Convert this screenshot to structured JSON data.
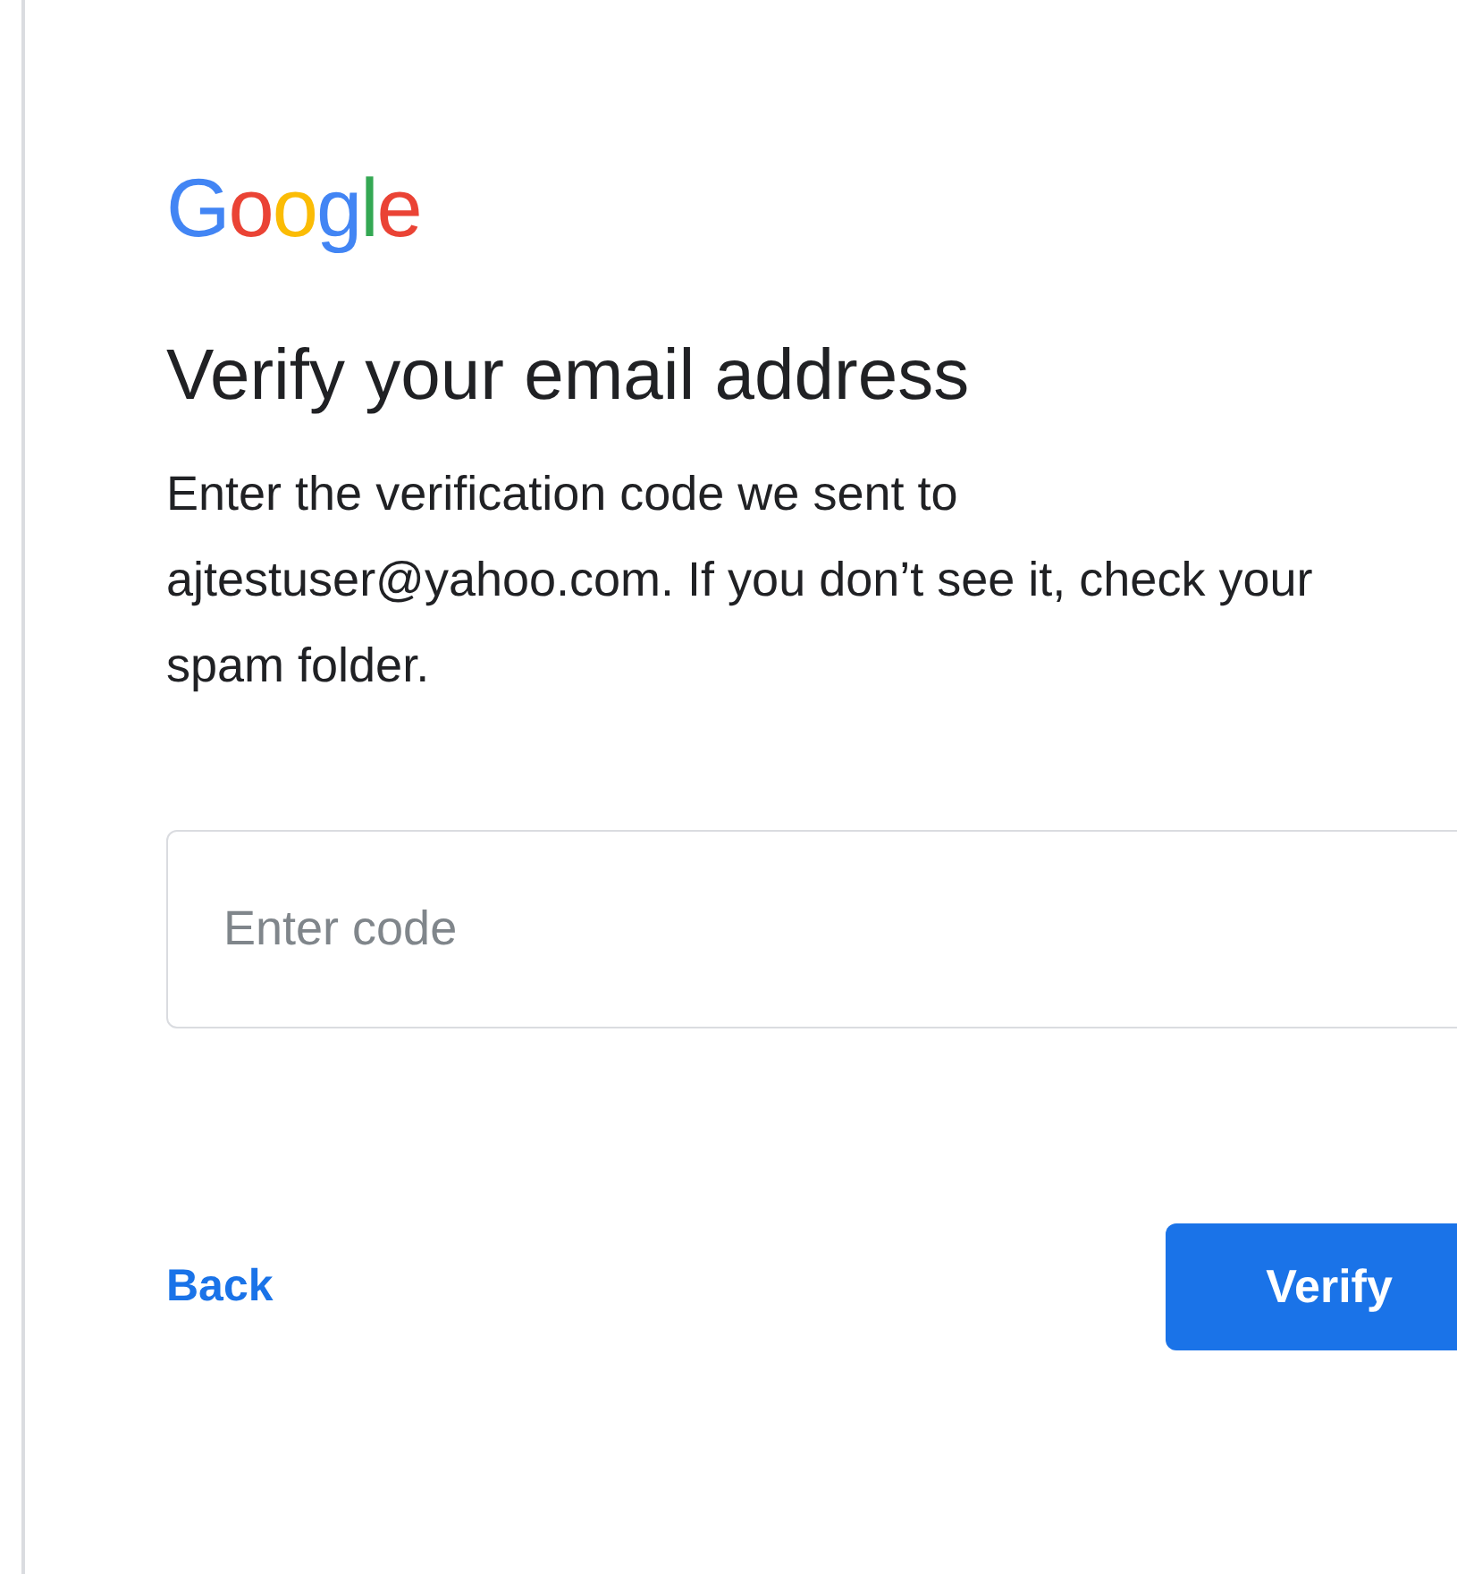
{
  "logo": {
    "letters": [
      {
        "char": "G",
        "color": "#4285f4"
      },
      {
        "char": "o",
        "color": "#ea4335"
      },
      {
        "char": "o",
        "color": "#fbbc05"
      },
      {
        "char": "g",
        "color": "#4285f4"
      },
      {
        "char": "l",
        "color": "#34a853"
      },
      {
        "char": "e",
        "color": "#ea4335"
      }
    ]
  },
  "heading": "Verify your email address",
  "message": "Enter the verification code we sent to ajtestuser@yahoo.com. If you don’t see it, check your spam folder.",
  "code_field": {
    "placeholder": "Enter code"
  },
  "buttons": [
    {
      "label": "Back",
      "kind": "text"
    },
    {
      "label": "Verify",
      "kind": "primary"
    }
  ]
}
